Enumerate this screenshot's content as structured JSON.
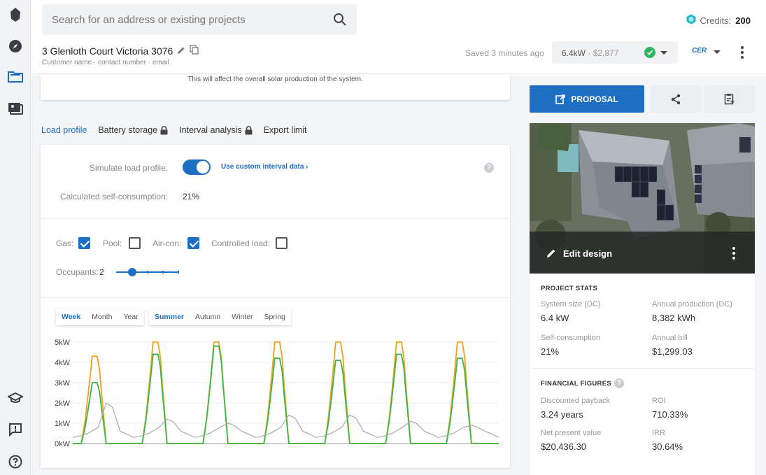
{
  "search": {
    "placeholder": "Search for an address or existing projects"
  },
  "credits": {
    "label": "Credits:",
    "value": "200"
  },
  "project": {
    "address": "3 Glenloth Court Victoria 3076",
    "subtitle": "Customer name · contact number · email",
    "saved": "Saved 3 minutes ago",
    "design_size": "6.4kW",
    "design_price": "· $2,877",
    "cer_badge": "CER"
  },
  "notice": "This will affect the overall solar production of the system.",
  "tabs": [
    {
      "label": "Load profile",
      "locked": false,
      "active": true
    },
    {
      "label": "Battery storage",
      "locked": true,
      "active": false
    },
    {
      "label": "Interval analysis",
      "locked": true,
      "active": false
    },
    {
      "label": "Export limit",
      "locked": false,
      "active": false
    }
  ],
  "load": {
    "simulate_label": "Simulate load profile:",
    "simulate_on": true,
    "custom_link": "Use custom interval data",
    "self_label": "Calculated self-consumption:",
    "self_value": "21%",
    "gas_label": "Gas:",
    "gas": true,
    "pool_label": "Pool:",
    "pool": false,
    "aircon_label": "Air-con:",
    "aircon": true,
    "controlled_label": "Controlled load:",
    "controlled": false,
    "occupants_label": "Occupants:",
    "occupants_value": "2",
    "occupants_fraction": 0.2
  },
  "period_tabs": {
    "week": "Week",
    "month": "Month",
    "year": "Year"
  },
  "season_tabs": {
    "summer": "Summer",
    "autumn": "Autumn",
    "winter": "Winter",
    "spring": "Spring"
  },
  "chart_data": {
    "type": "line",
    "ylim": [
      0,
      5
    ],
    "yticks": [
      "0kW",
      "1kW",
      "2kW",
      "3kW",
      "4kW",
      "5kW"
    ],
    "series": [
      {
        "color": "#f0a21b",
        "peaks": [
          4.3,
          5.0,
          5.0,
          5.0,
          5.0,
          5.0,
          5.0
        ]
      },
      {
        "color": "#3cb54a",
        "peaks": [
          3.0,
          4.4,
          4.8,
          4.2,
          4.1,
          4.4,
          4.2
        ]
      },
      {
        "color": "#a9a9a9",
        "peaks": [
          2.0,
          1.2,
          1.0,
          1.4,
          1.4,
          1.1,
          0.9
        ]
      }
    ]
  },
  "actions": {
    "proposal": "PROPOSAL"
  },
  "edit_design": "Edit design",
  "stats": {
    "project_title": "PROJECT STATS",
    "system_size_label": "System size (DC)",
    "system_size": "6.4 kW",
    "annual_prod_label": "Annual production (DC)",
    "annual_prod": "8,382 kWh",
    "self_label": "Self-consumption",
    "self": "21%",
    "bill_label": "Annual bill",
    "bill": "$1,299.03",
    "financial_title": "FINANCIAL FIGURES",
    "payback_label": "Discounted payback",
    "payback": "3.24 years",
    "roi_label": "ROI",
    "roi": "710.33%",
    "npv_label": "Net present value",
    "npv": "$20,436.30",
    "irr_label": "IRR",
    "irr": "30.64%"
  },
  "colors": {
    "accent": "#1d6fc4",
    "success": "#2fb463",
    "credit_icon": "#1fb6c9"
  }
}
